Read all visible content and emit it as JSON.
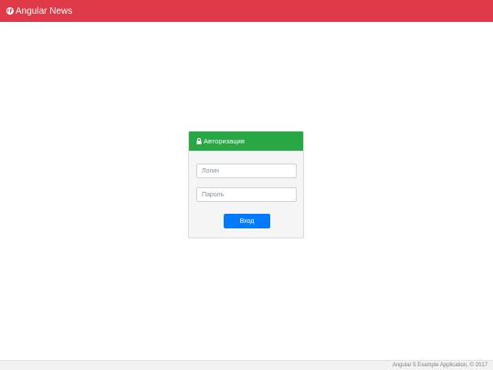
{
  "navbar": {
    "brand_icon": "globe-icon",
    "brand_label": "Angular News",
    "background_color": "#e03a48"
  },
  "login_card": {
    "header_icon": "lock-icon",
    "header_title": "Авторизация",
    "header_color": "#28a745",
    "login_field": {
      "placeholder": "Логин",
      "value": ""
    },
    "password_field": {
      "placeholder": "Пароль",
      "value": ""
    },
    "submit_label": "Вход",
    "submit_color": "#007bff"
  },
  "footer": {
    "text": "Angular 5 Example Application, © 2017"
  }
}
